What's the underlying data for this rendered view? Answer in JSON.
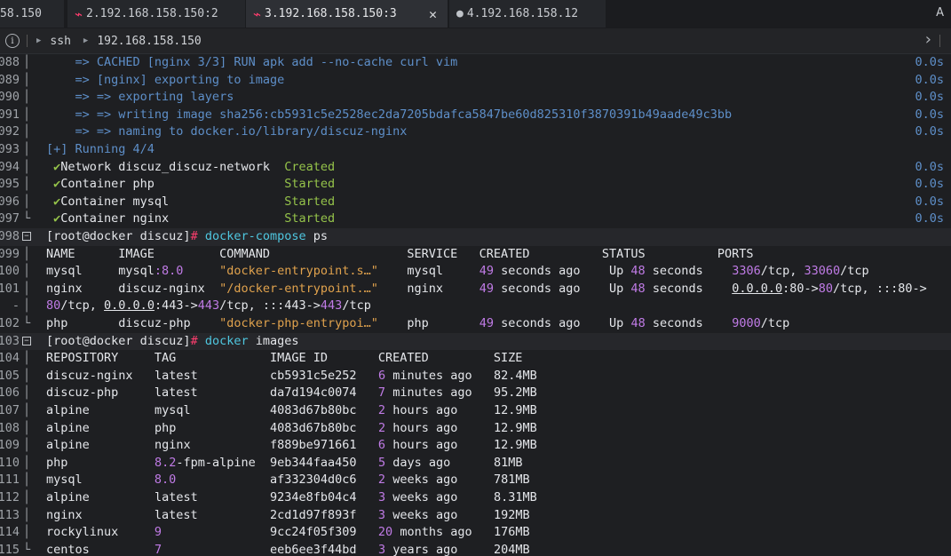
{
  "tabs": [
    {
      "label": "58.150",
      "icon": "",
      "active": false
    },
    {
      "label": "2.192.168.158.150:2",
      "icon": "terminal-icon",
      "active": false
    },
    {
      "label": "3.192.168.158.150:3",
      "icon": "terminal-icon",
      "active": true
    },
    {
      "label": "4.192.168.158.12",
      "icon": "apple-icon",
      "active": false
    }
  ],
  "tab_right_label": "A",
  "address": {
    "protocol": "ssh",
    "host": "192.168.158.150"
  },
  "terminal_lines": [
    {
      "n": "088",
      "text": "    => CACHED [nginx 3/3] RUN apk add --no-cache curl vim",
      "time": "0.0s",
      "style": "blue"
    },
    {
      "n": "089",
      "text": "    => [nginx] exporting to image",
      "time": "0.0s",
      "style": "blue"
    },
    {
      "n": "090",
      "text": "    => => exporting layers",
      "time": "0.0s",
      "style": "blue"
    },
    {
      "n": "091",
      "text": "    => => writing image sha256:cb5931c5e2528ec2da7205bdafca5847be60d825310f3870391b49aade49c3bb",
      "time": "0.0s",
      "style": "blue"
    },
    {
      "n": "092",
      "text": "    => => naming to docker.io/library/discuz-nginx",
      "time": "0.0s",
      "style": "blue"
    },
    {
      "n": "093",
      "text": "[+] Running 4/4",
      "time": "",
      "style": "blue"
    },
    {
      "n": "094",
      "text": "Network discuz_discuz-network",
      "status": "Created",
      "time": "0.0s",
      "style": "check"
    },
    {
      "n": "095",
      "text": "Container php",
      "status": "Started",
      "time": "0.0s",
      "style": "check"
    },
    {
      "n": "096",
      "text": "Container mysql",
      "status": "Started",
      "time": "0.0s",
      "style": "check"
    },
    {
      "n": "097",
      "text": "Container nginx",
      "status": "Started",
      "time": "0.0s",
      "style": "check"
    },
    {
      "n": "098",
      "prompt": "[root@docker discuz]",
      "hash": "#",
      "cmd": "docker-compose",
      "arg": "ps",
      "style": "prompt"
    },
    {
      "n": "099",
      "text": "NAME      IMAGE         COMMAND                   SERVICE   CREATED          STATUS          PORTS",
      "style": "plain"
    },
    {
      "n": "100",
      "style": "ps_mysql"
    },
    {
      "n": "101",
      "style": "ps_nginx"
    },
    {
      "n": "-",
      "style": "ps_nginx_cont"
    },
    {
      "n": "102",
      "style": "ps_php"
    },
    {
      "n": "103",
      "prompt": "[root@docker discuz]",
      "hash": "#",
      "cmd": "docker",
      "arg": "images",
      "style": "prompt"
    },
    {
      "n": "104",
      "text": "REPOSITORY     TAG             IMAGE ID       CREATED         SIZE",
      "style": "plain"
    },
    {
      "n": "105",
      "repo": "discuz-nginx",
      "tag": "latest",
      "id": "cb5931c5e252",
      "created_n": "6",
      "created_t": " minutes ago",
      "size": "82.4MB",
      "style": "img"
    },
    {
      "n": "106",
      "repo": "discuz-php",
      "tag": "latest",
      "id": "da7d194c0074",
      "created_n": "7",
      "created_t": " minutes ago",
      "size": "95.2MB",
      "style": "img"
    },
    {
      "n": "107",
      "repo": "alpine",
      "tag": "mysql",
      "id": "4083d67b80bc",
      "created_n": "2",
      "created_t": " hours ago",
      "size": "12.9MB",
      "style": "img"
    },
    {
      "n": "108",
      "repo": "alpine",
      "tag": "php",
      "id": "4083d67b80bc",
      "created_n": "2",
      "created_t": " hours ago",
      "size": "12.9MB",
      "style": "img"
    },
    {
      "n": "109",
      "repo": "alpine",
      "tag": "nginx",
      "id": "f889be971661",
      "created_n": "6",
      "created_t": " hours ago",
      "size": "12.9MB",
      "style": "img"
    },
    {
      "n": "110",
      "repo": "php",
      "tag": "8.2-fpm-alpine",
      "id": "9eb344faa450",
      "created_n": "5",
      "created_t": " days ago",
      "size": "81MB",
      "style": "img"
    },
    {
      "n": "111",
      "repo": "mysql",
      "tag": "8.0",
      "id": "af332304d0c6",
      "created_n": "2",
      "created_t": " weeks ago",
      "size": "781MB",
      "style": "img"
    },
    {
      "n": "112",
      "repo": "alpine",
      "tag": "latest",
      "id": "9234e8fb04c4",
      "created_n": "3",
      "created_t": " weeks ago",
      "size": "8.31MB",
      "style": "img"
    },
    {
      "n": "113",
      "repo": "nginx",
      "tag": "latest",
      "id": "2cd1d97f893f",
      "created_n": "3",
      "created_t": " weeks ago",
      "size": "192MB",
      "style": "img"
    },
    {
      "n": "114",
      "repo": "rockylinux",
      "tag": "9",
      "id": "9cc24f05f309",
      "created_n": "20",
      "created_t": " months ago",
      "size": "176MB",
      "style": "img"
    },
    {
      "n": "115",
      "repo": "centos",
      "tag": "7",
      "id": "eeb6ee3f44bd",
      "created_n": "3",
      "created_t": " years ago",
      "size": "204MB",
      "style": "img"
    }
  ],
  "ps_rows": {
    "mysql": {
      "name": "mysql",
      "image_a": "mysql",
      "image_b": ":8.0",
      "command": "\"docker-entrypoint.s…\"",
      "service": "mysql",
      "created_n": "49",
      "created_t": " seconds ago",
      "status_a": "Up ",
      "status_n": "48",
      "status_t": " seconds",
      "ports": [
        [
          "3306",
          "purple"
        ],
        [
          "/tcp, ",
          "white"
        ],
        [
          "33060",
          "purple"
        ],
        [
          "/tcp",
          "white"
        ]
      ]
    },
    "nginx": {
      "name": "nginx",
      "image": "discuz-nginx",
      "command": "\"/docker-entrypoint.…\"",
      "service": "nginx",
      "created_n": "49",
      "created_t": " seconds ago",
      "status_a": "Up ",
      "status_n": "48",
      "status_t": " seconds",
      "ports": [
        [
          "0.0.0.0",
          "ul"
        ],
        [
          ":80->",
          "white"
        ],
        [
          "80",
          "purple"
        ],
        [
          "/tcp, ",
          "white"
        ],
        [
          ":::80->",
          "white"
        ]
      ]
    },
    "nginx_cont": [
      [
        "80",
        "purple"
      ],
      [
        "/tcp, ",
        "white"
      ],
      [
        "0.0.0.0",
        "ul"
      ],
      [
        ":443->",
        "white"
      ],
      [
        "443",
        "purple"
      ],
      [
        "/tcp, :::443->",
        "white"
      ],
      [
        "443",
        "purple"
      ],
      [
        "/tcp",
        "white"
      ]
    ],
    "php": {
      "name": "php",
      "image": "discuz-php",
      "command": "\"docker-php-entrypoi…\"",
      "service": "php",
      "created_n": "49",
      "created_t": " seconds ago",
      "status_a": "Up ",
      "status_n": "48",
      "status_t": " seconds",
      "ports": [
        [
          "9000",
          "purple"
        ],
        [
          "/tcp",
          "white"
        ]
      ]
    }
  },
  "colors": {
    "background": "#1e1f22",
    "tab_active": "#2e3035",
    "prompt_blue": "#4fc7e0",
    "number_purple": "#c07be6",
    "ok_green": "#95c34a",
    "log_blue": "#5e8fc9",
    "accent_pink": "#ff3d6e"
  }
}
